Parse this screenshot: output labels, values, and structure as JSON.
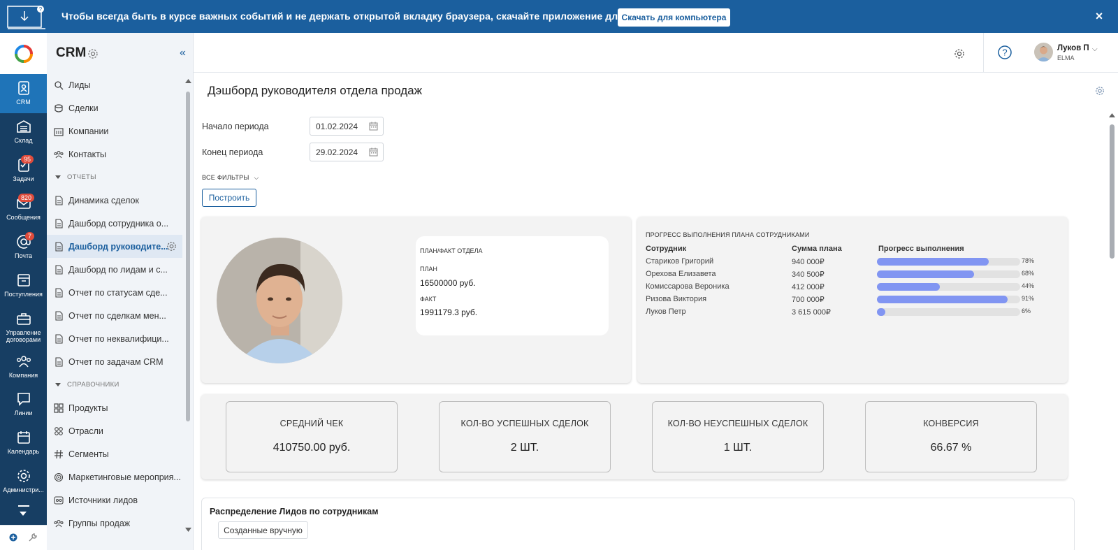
{
  "banner": {
    "text": "Чтобы всегда быть в курсе важных событий и не держать открытой вкладку браузера, скачайте приложение для рабочего стола.",
    "button": "Скачать для компьютера",
    "close": "×"
  },
  "rail": {
    "items": [
      {
        "label": "CRM",
        "icon": "crm-icon"
      },
      {
        "label": "Склад",
        "icon": "warehouse-icon"
      },
      {
        "label": "Задачи",
        "icon": "tasks-icon",
        "badge": "95"
      },
      {
        "label": "Сообщения",
        "icon": "messages-icon",
        "badge": "820"
      },
      {
        "label": "Почта",
        "icon": "mail-icon",
        "badge": "7"
      },
      {
        "label": "Поступления",
        "icon": "inbox-icon"
      },
      {
        "label": "Управление договорами",
        "icon": "contracts-icon"
      },
      {
        "label": "Компания",
        "icon": "company-icon"
      },
      {
        "label": "Линии",
        "icon": "chat-lines-icon"
      },
      {
        "label": "Календарь",
        "icon": "calendar-icon"
      },
      {
        "label": "Администри...",
        "icon": "admin-gear-icon"
      }
    ]
  },
  "sidebar": {
    "title": "CRM",
    "items_top": [
      "Лиды",
      "Сделки",
      "Компании",
      "Контакты"
    ],
    "section_reports": "ОТЧЕТЫ",
    "reports": [
      "Динамика сделок",
      "Дашборд сотрудника о...",
      "Дашборд руководите...",
      "Дашборд по лидам и с...",
      "Отчет по статусам сде...",
      "Отчет по сделкам мен...",
      "Отчет по неквалифици...",
      "Отчет по задачам CRM"
    ],
    "section_refs": "СПРАВОЧНИКИ",
    "refs": [
      "Продукты",
      "Отрасли",
      "Сегменты",
      "Маркетинговые мероприя...",
      "Источники лидов",
      "Группы продаж"
    ]
  },
  "header": {
    "user_name": "Луков П",
    "org": "ELMA"
  },
  "page": {
    "title": "Дэшборд руководителя отдела продаж",
    "period_start_label": "Начало периода",
    "period_start_value": "01.02.2024",
    "period_end_label": "Конец периода",
    "period_end_value": "29.02.2024",
    "filters_link": "ВСЕ ФИЛЬТРЫ",
    "build_button": "Построить"
  },
  "plan_fact": {
    "title": "ПЛАН/ФАКТ ОТДЕЛА",
    "plan_label": "ПЛАН",
    "plan_value": "16500000 руб.",
    "fact_label": "ФАКТ",
    "fact_value": "1991179.3 руб."
  },
  "progress": {
    "title": "ПРОГРЕСС ВЫПОЛНЕНИЯ ПЛАНА СОТРУДНИКАМИ",
    "col_employee": "Сотрудник",
    "col_sum": "Сумма плана",
    "col_progress": "Прогресс выполнения",
    "rows": [
      {
        "name": "Стариков Григорий",
        "sum": "940 000₽",
        "pct": "78%",
        "value": 0.78
      },
      {
        "name": "Орехова Елизавета",
        "sum": "340 500₽",
        "pct": "68%",
        "value": 0.68
      },
      {
        "name": "Комиссарова Вероника",
        "sum": "412 000₽",
        "pct": "44%",
        "value": 0.44
      },
      {
        "name": "Ризова Виктория",
        "sum": "700 000₽",
        "pct": "91%",
        "value": 0.91
      },
      {
        "name": "Луков Петр",
        "sum": "3 615 000₽",
        "pct": "6%",
        "value": 0.06
      }
    ],
    "bar_color": "#8195f2"
  },
  "kpis": [
    {
      "label": "СРЕДНИЙ ЧЕК",
      "value": "410750.00 руб."
    },
    {
      "label": "КОЛ-ВО УСПЕШНЫХ СДЕЛОК",
      "value": "2 ШТ."
    },
    {
      "label": "КОЛ-ВО НЕУСПЕШНЫХ СДЕЛОК",
      "value": "1 ШТ."
    },
    {
      "label": "КОНВЕРСИЯ",
      "value": "66.67 %"
    }
  ],
  "leads": {
    "title": "Распределение Лидов по сотрудникам",
    "tab": "Созданные вручную"
  },
  "colors": {
    "brand": "#1b5f9e",
    "rail": "#173e63",
    "rail_active": "#1f74b8",
    "badge": "#e04b3b"
  }
}
